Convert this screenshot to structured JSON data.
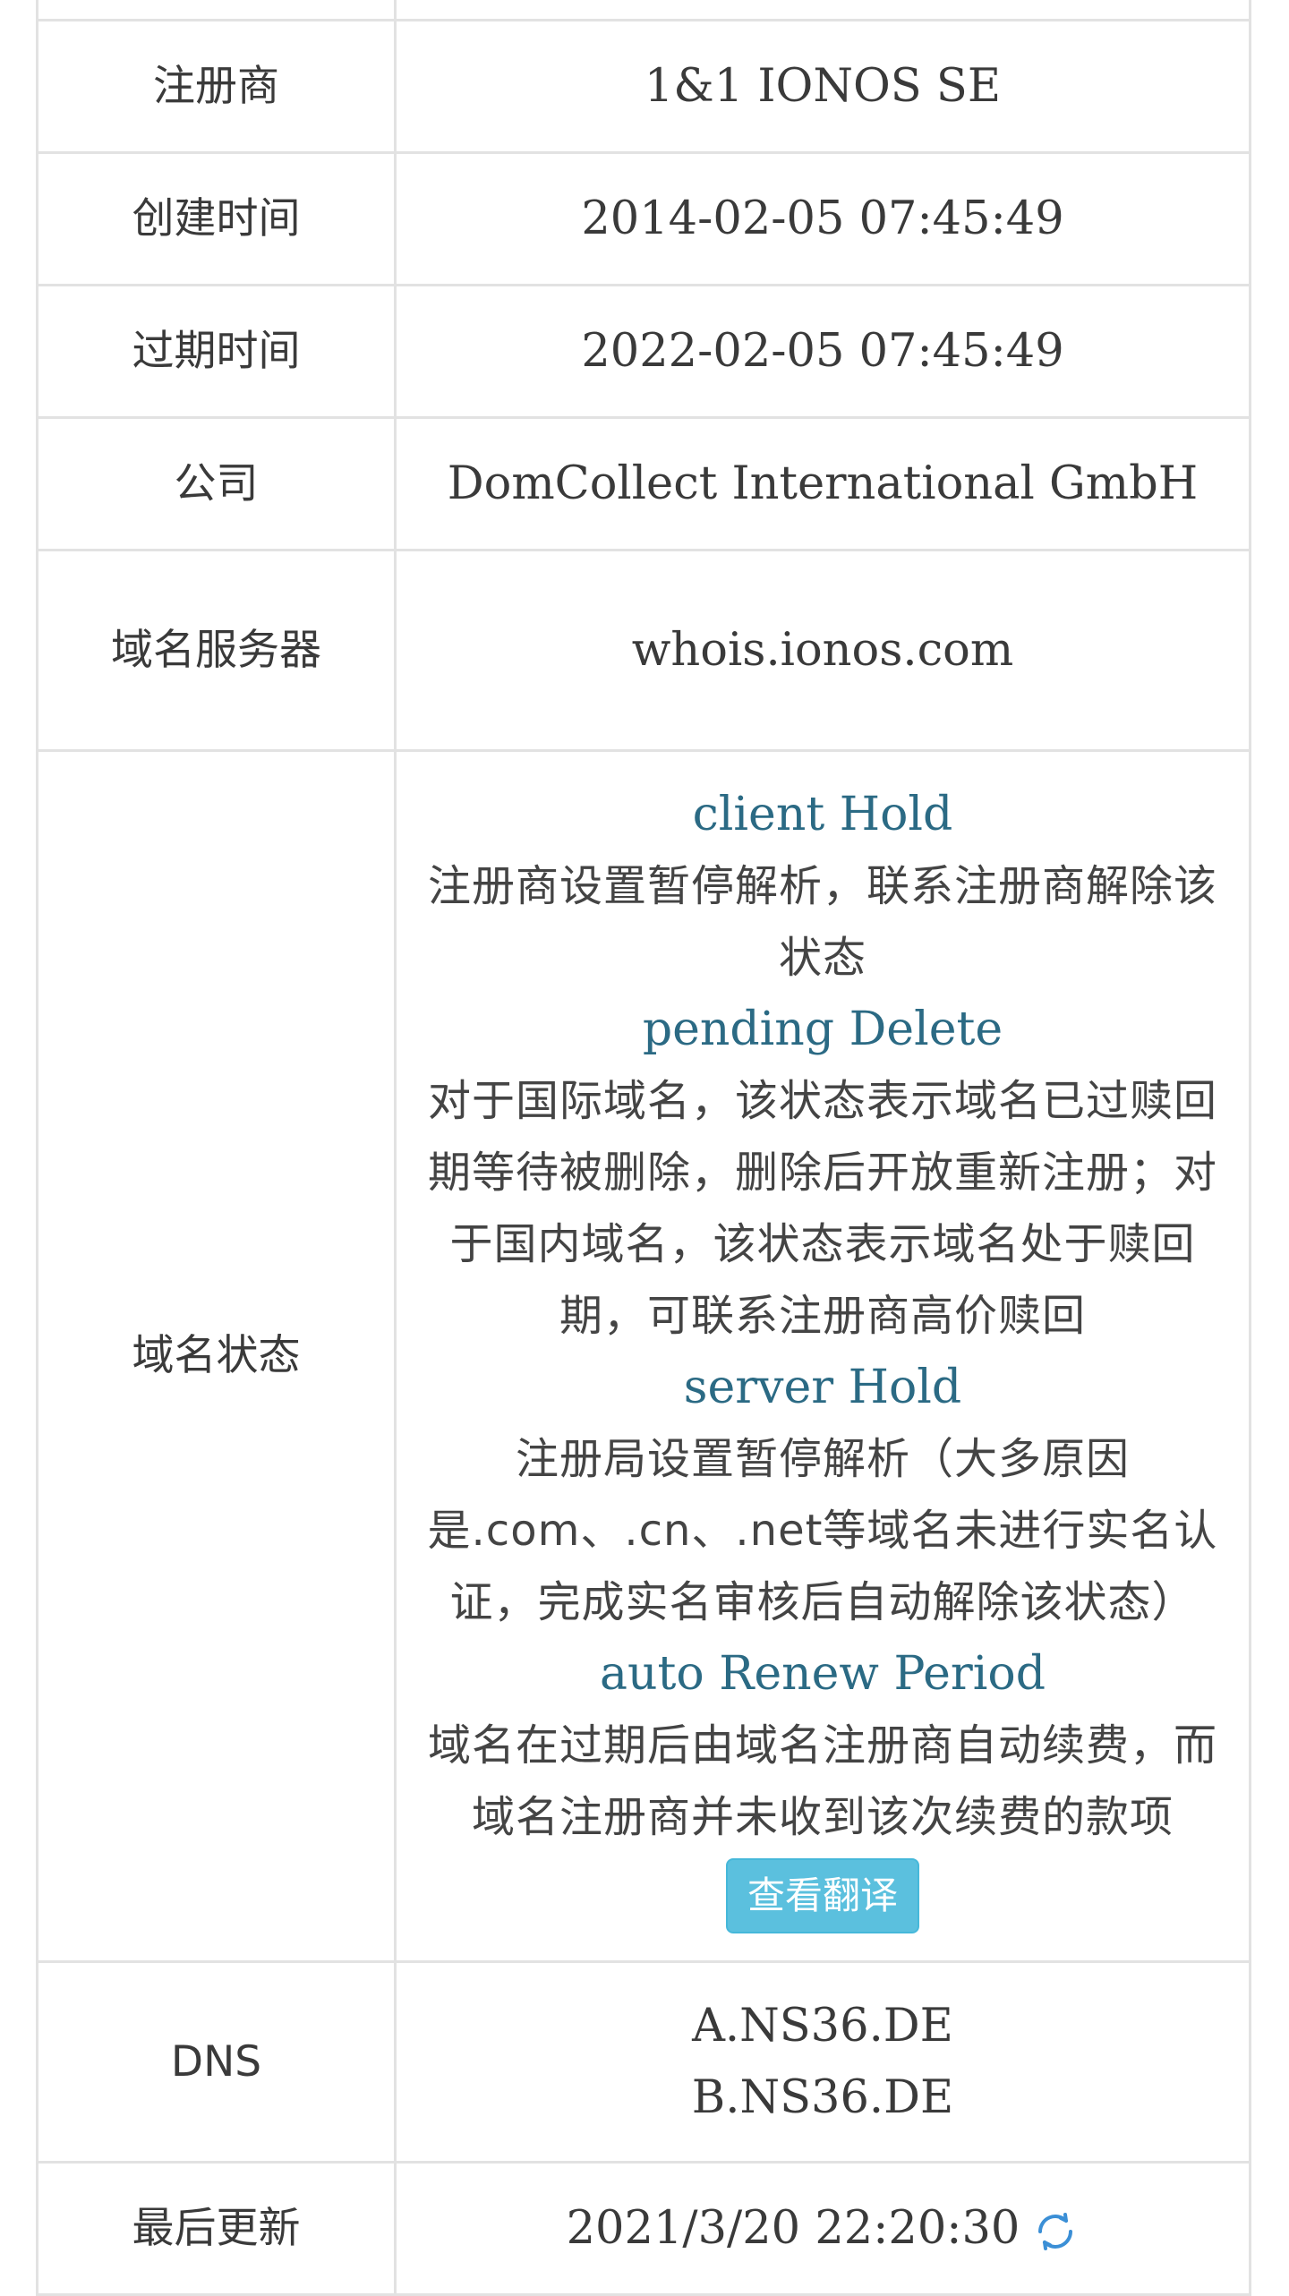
{
  "rows": {
    "registrar": {
      "label": "注册商",
      "value": "1&1 IONOS SE"
    },
    "created": {
      "label": "创建时间",
      "value": "2014-02-05 07:45:49"
    },
    "expires": {
      "label": "过期时间",
      "value": "2022-02-05 07:45:49"
    },
    "company": {
      "label": "公司",
      "value": "DomCollect International GmbH"
    },
    "nameserver": {
      "label": "域名服务器",
      "value": "whois.ionos.com"
    },
    "status": {
      "label": "域名状态",
      "items": [
        {
          "code": "client Hold",
          "desc": "注册商设置暂停解析，联系注册商解除该状态"
        },
        {
          "code": "pending Delete",
          "desc": "对于国际域名，该状态表示域名已过赎回期等待被删除，删除后开放重新注册；对于国内域名，该状态表示域名处于赎回期，可联系注册商高价赎回"
        },
        {
          "code": "server Hold",
          "desc": "注册局设置暂停解析（大多原因是.com、.cn、.net等域名未进行实名认证，完成实名审核后自动解除该状态）"
        },
        {
          "code": "auto Renew Period",
          "desc": "域名在过期后由域名注册商自动续费，而域名注册商并未收到该次续费的款项"
        }
      ],
      "translate_button": "查看翻译"
    },
    "dns": {
      "label": "DNS",
      "values": [
        "A.NS36.DE",
        "B.NS36.DE"
      ]
    },
    "updated": {
      "label": "最后更新",
      "value": "2021/3/20 22:20:30",
      "icon": "refresh-icon"
    }
  },
  "colors": {
    "status_code": "#2b6a84",
    "button_bg": "#5bc0de",
    "border": "#e2e2e2",
    "refresh_icon": "#3b8fd6"
  }
}
